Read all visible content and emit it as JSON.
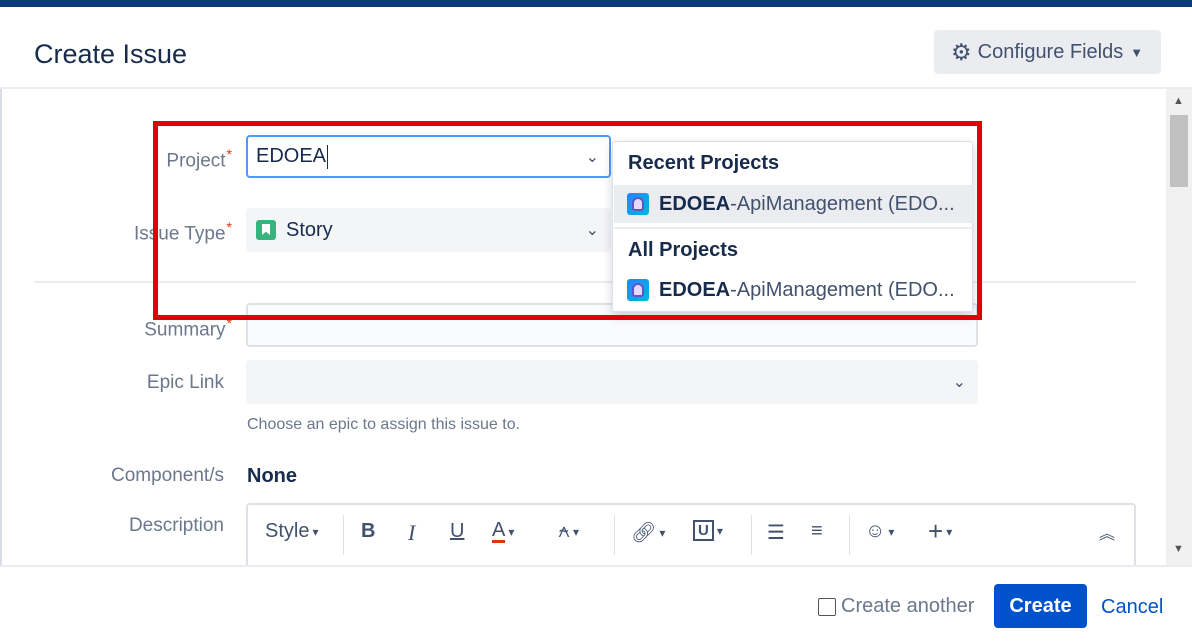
{
  "dialog": {
    "title": "Create Issue",
    "configure_fields_label": "Configure Fields"
  },
  "fields": {
    "project": {
      "label": "Project",
      "value": "EDOEA"
    },
    "issue_type": {
      "label": "Issue Type",
      "value": "Story"
    },
    "summary": {
      "label": "Summary",
      "value": ""
    },
    "epic_link": {
      "label": "Epic Link",
      "value": "",
      "help": "Choose an epic to assign this issue to."
    },
    "components": {
      "label": "Component/s",
      "value": "None"
    },
    "description": {
      "label": "Description"
    }
  },
  "required_marker": "*",
  "project_dropdown": {
    "recent_heading": "Recent Projects",
    "recent_items": [
      {
        "match": "EDOEA",
        "rest": "-ApiManagement (EDO..."
      }
    ],
    "all_heading": "All Projects",
    "all_items": [
      {
        "match": "EDOEA",
        "rest": "-ApiManagement (EDO..."
      }
    ]
  },
  "editor_toolbar": {
    "style_label": "Style",
    "bold": "B",
    "italic": "I",
    "underline": "U",
    "text_color": "A"
  },
  "footer": {
    "create_another_label": "Create another",
    "create_another_checked": false,
    "create_label": "Create",
    "cancel_label": "Cancel"
  },
  "colors": {
    "primary": "#0052cc",
    "highlight_border": "#e0000a",
    "story_icon": "#36b37e",
    "focus_border": "#4c9aff"
  }
}
